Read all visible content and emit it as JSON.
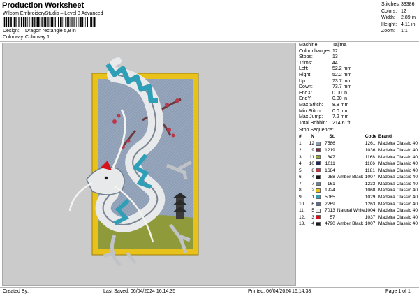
{
  "header": {
    "title": "Production Worksheet",
    "subtitle": "Wilcom EmbroideryStudio – Level 3 Advanced",
    "design_label": "Design:",
    "design_value": "Dragon rectangle 5,8 in",
    "colorway_label": "Colorway:",
    "colorway_value": "Colorway 1"
  },
  "top_stats": [
    {
      "label": "Stitches:",
      "value": "33386"
    },
    {
      "label": "Colors:",
      "value": "12"
    },
    {
      "label": "Width:",
      "value": "2.89 in"
    },
    {
      "label": "Height:",
      "value": "4.11 in"
    },
    {
      "label": "Zoom:",
      "value": "1:1"
    }
  ],
  "info": [
    {
      "label": "Machine:",
      "value": "Tajima"
    },
    {
      "label": "Color changes:",
      "value": "12"
    },
    {
      "label": "Stops:",
      "value": "13"
    },
    {
      "label": "Trims:",
      "value": "44"
    },
    {
      "label": "Left:",
      "value": "52.2 mm"
    },
    {
      "label": "Right:",
      "value": "52.2 mm"
    },
    {
      "label": "Up:",
      "value": "73.7 mm"
    },
    {
      "label": "Down:",
      "value": "73.7 mm"
    },
    {
      "label": "EndX:",
      "value": "0.00 in"
    },
    {
      "label": "EndY:",
      "value": "0.00 in"
    },
    {
      "label": "Max Stitch:",
      "value": "8.8 mm"
    },
    {
      "label": "Min Stitch:",
      "value": "0.0 mm"
    },
    {
      "label": "Max Jump:",
      "value": "7.2 mm"
    },
    {
      "label": "Total Bobbin:",
      "value": "214.61ft"
    }
  ],
  "sequence": {
    "title": "Stop Sequence:",
    "headers": [
      "#",
      "N",
      "St.",
      "Code",
      "Brand"
    ],
    "rows": [
      {
        "idx": "1.",
        "n": "12",
        "st": "7586",
        "name": "",
        "color": "#8a9cad",
        "code": "1261",
        "brand": "Madeira Classic 40"
      },
      {
        "idx": "2.",
        "n": "9",
        "st": "1219",
        "name": "",
        "color": "#7a2b45",
        "code": "1036",
        "brand": "Madeira Classic 40"
      },
      {
        "idx": "3.",
        "n": "11",
        "st": "347",
        "name": "",
        "color": "#9aa63c",
        "code": "1168",
        "brand": "Madeira Classic 40"
      },
      {
        "idx": "4.",
        "n": "10",
        "st": "1011",
        "name": "",
        "color": "#1f2a5a",
        "code": "1166",
        "brand": "Madeira Classic 40"
      },
      {
        "idx": "5.",
        "n": "8",
        "st": "1684",
        "name": "",
        "color": "#b8384a",
        "code": "1181",
        "brand": "Madeira Classic 40"
      },
      {
        "idx": "6.",
        "n": "4",
        "st": "258",
        "name": "Amber Black",
        "color": "#1a1a1a",
        "code": "1007",
        "brand": "Madeira Classic 40"
      },
      {
        "idx": "7.",
        "n": "7",
        "st": "161",
        "name": "",
        "color": "#6e7f8e",
        "code": "1233",
        "brand": "Madeira Classic 40"
      },
      {
        "idx": "8.",
        "n": "2",
        "st": "1924",
        "name": "",
        "color": "#e8c21a",
        "code": "1068",
        "brand": "Madeira Classic 40"
      },
      {
        "idx": "9.",
        "n": "1",
        "st": "5065",
        "name": "",
        "color": "#2f9fb8",
        "code": "1029",
        "brand": "Madeira Classic 40"
      },
      {
        "idx": "10.",
        "n": "6",
        "st": "2269",
        "name": "",
        "color": "#5e6c86",
        "code": "1263",
        "brand": "Madeira Classic 40"
      },
      {
        "idx": "11.",
        "n": "5",
        "st": "7013",
        "name": "Natural White",
        "color": "#f3f3f0",
        "code": "1004",
        "brand": "Madeira Classic 40"
      },
      {
        "idx": "12.",
        "n": "3",
        "st": "57",
        "name": "",
        "color": "#d4131c",
        "code": "1037",
        "brand": "Madeira Classic 40"
      },
      {
        "idx": "13.",
        "n": "4",
        "st": "4790",
        "name": "Amber Black",
        "color": "#1a1a1a",
        "code": "1007",
        "brand": "Madeira Classic 40"
      }
    ]
  },
  "footer": {
    "created_by": "Created By:",
    "last_saved": "Last Saved: 06/04/2024 16.14.35",
    "printed": "Printed: 06/04/2024 16.14.38",
    "page": "Page 1 of 1"
  }
}
